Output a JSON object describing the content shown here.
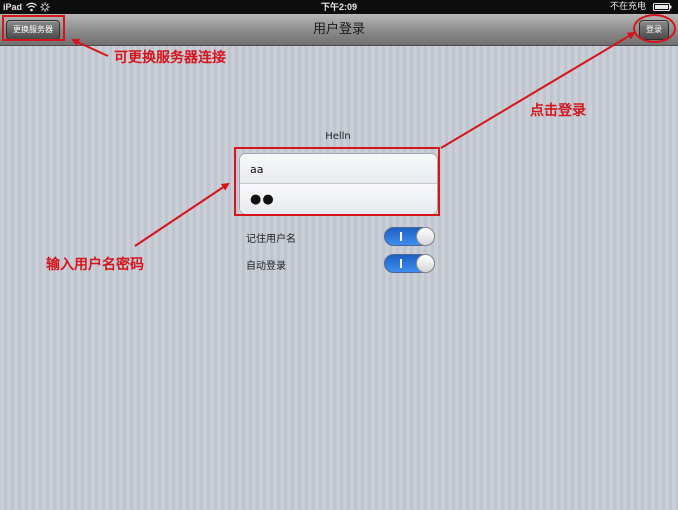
{
  "status_bar": {
    "device": "iPad",
    "time": "下午2:09",
    "charge_status": "不在充电"
  },
  "nav_bar": {
    "title": "用户登录",
    "left_button_label": "更换服务器",
    "right_button_label": "登录"
  },
  "form": {
    "header": "Helln",
    "username_value": "aa",
    "password_value": "●●",
    "remember_username_label": "记住用户名",
    "remember_username_on": true,
    "auto_login_label": "自动登录",
    "auto_login_on": true
  },
  "annotations": {
    "server_note": "可更换服务器连接",
    "login_note": "点击登录",
    "credentials_note": "输入用户名密码",
    "color": "#d6141c"
  },
  "icons": [
    "wifi-icon",
    "activity-icon",
    "battery-icon"
  ]
}
